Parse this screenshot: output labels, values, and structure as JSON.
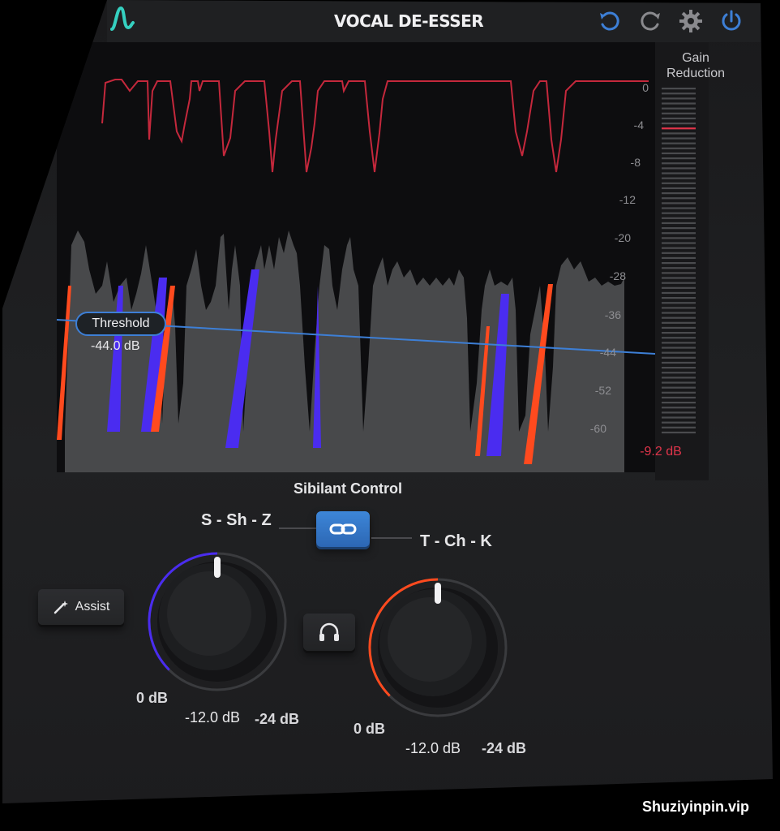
{
  "header": {
    "title": "VOCAL DE-ESSER",
    "icons": [
      "logo-icon",
      "undo-icon",
      "redo-icon",
      "settings-gear-icon",
      "power-icon"
    ]
  },
  "display": {
    "scale_labels": [
      "0",
      "-4",
      "-8",
      "-12",
      "-20",
      "-28",
      "-36",
      "-44",
      "-52",
      "-60"
    ],
    "threshold": {
      "label": "Threshold",
      "value": "-44.0 dB"
    }
  },
  "gain_reduction": {
    "label_line1": "Gain",
    "label_line2": "Reduction",
    "value": "-9.2 dB",
    "level_db": -9.2
  },
  "controls": {
    "section_title": "Sibilant Control",
    "assist_label": "Assist",
    "band_left": {
      "name": "S - Sh - Z",
      "min_label": "0 dB",
      "value_label": "-12.0 dB",
      "max_label": "-24 dB",
      "value_db": -12.0
    },
    "band_right": {
      "name": "T - Ch - K",
      "min_label": "0 dB",
      "value_label": "-12.0 dB",
      "max_label": "-24 dB",
      "value_db": -12.0
    }
  },
  "colors": {
    "accent_blue": "#3d7fd6",
    "reduction_red": "#e0344a",
    "s_band_purple": "#4a2cf0",
    "t_band_orange": "#ff4a1e",
    "logo_teal": "#35d0c0"
  },
  "watermark": "Shuziyinpin.vip"
}
